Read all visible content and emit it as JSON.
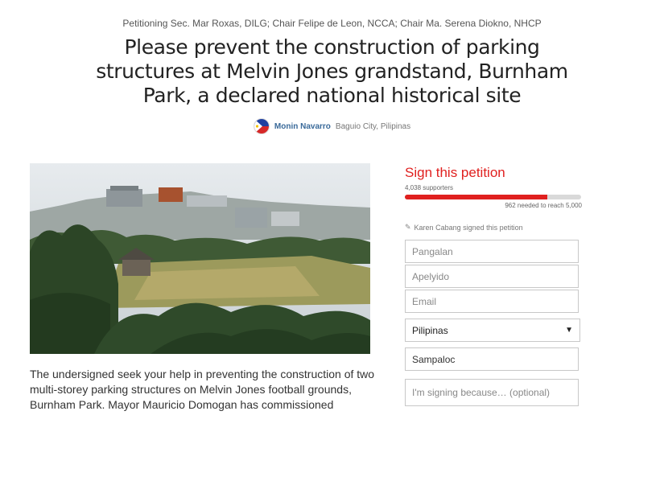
{
  "petitioning": "Petitioning Sec. Mar Roxas, DILG; Chair Felipe de Leon, NCCA; Chair Ma. Serena Diokno, NHCP",
  "title": "Please prevent the construction of parking structures at Melvin Jones grandstand, Burnham Park, a declared national historical site",
  "author": {
    "name": "Monin Navarro",
    "location": "Baguio City, Pilipinas"
  },
  "body": "The undersigned seek your help in preventing the construction of two multi-storey parking structures on Melvin Jones football grounds, Burnham Park. Mayor Mauricio Domogan has commissioned",
  "sign": {
    "title": "Sign this petition",
    "supporters": "4,038 supporters",
    "progress_fraction": 0.81,
    "needed": "962 needed to reach 5,000",
    "recent_signer": "Karen Cabang signed this petition",
    "fields": {
      "first_name_placeholder": "Pangalan",
      "last_name_placeholder": "Apelyido",
      "email_placeholder": "Email",
      "country": "Pilipinas",
      "city_value": "Sampaloc",
      "reason_placeholder": "I'm signing because… (optional)"
    }
  },
  "colors": {
    "accent": "#e0201f",
    "link": "#3a6a9a"
  },
  "icons": [
    "flag-avatar-icon",
    "pencil-icon",
    "caret-down-icon"
  ]
}
